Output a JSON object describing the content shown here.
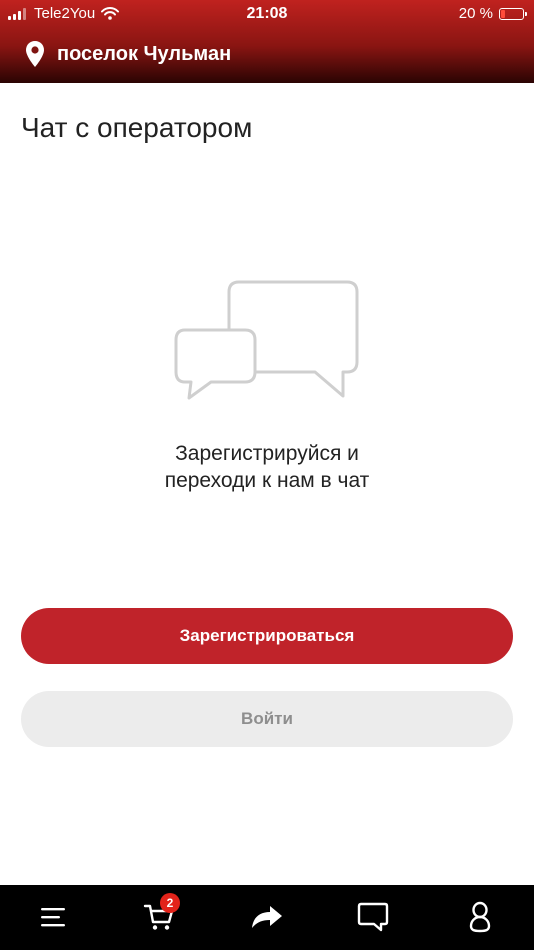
{
  "status_bar": {
    "carrier": "Tele2You",
    "time": "21:08",
    "battery_percent": "20 %",
    "battery_level": 0.2
  },
  "header": {
    "location": "поселок Чульман",
    "location_icon": "map-pin-icon"
  },
  "page": {
    "title": "Чат с оператором",
    "illustration_icon": "chat-bubbles-icon",
    "message_line1": "Зарегистрируйся и",
    "message_line2": "переходи к нам в чат"
  },
  "buttons": {
    "register_label": "Зарегистрироваться",
    "login_label": "Войти"
  },
  "tabbar": {
    "items": [
      {
        "icon": "menu-icon"
      },
      {
        "icon": "cart-icon",
        "badge": "2"
      },
      {
        "icon": "share-icon"
      },
      {
        "icon": "chat-icon"
      },
      {
        "icon": "profile-icon"
      }
    ]
  },
  "colors": {
    "brand_red": "#c0232a",
    "badge_red": "#e2231a",
    "tabbar_bg": "#000000"
  }
}
